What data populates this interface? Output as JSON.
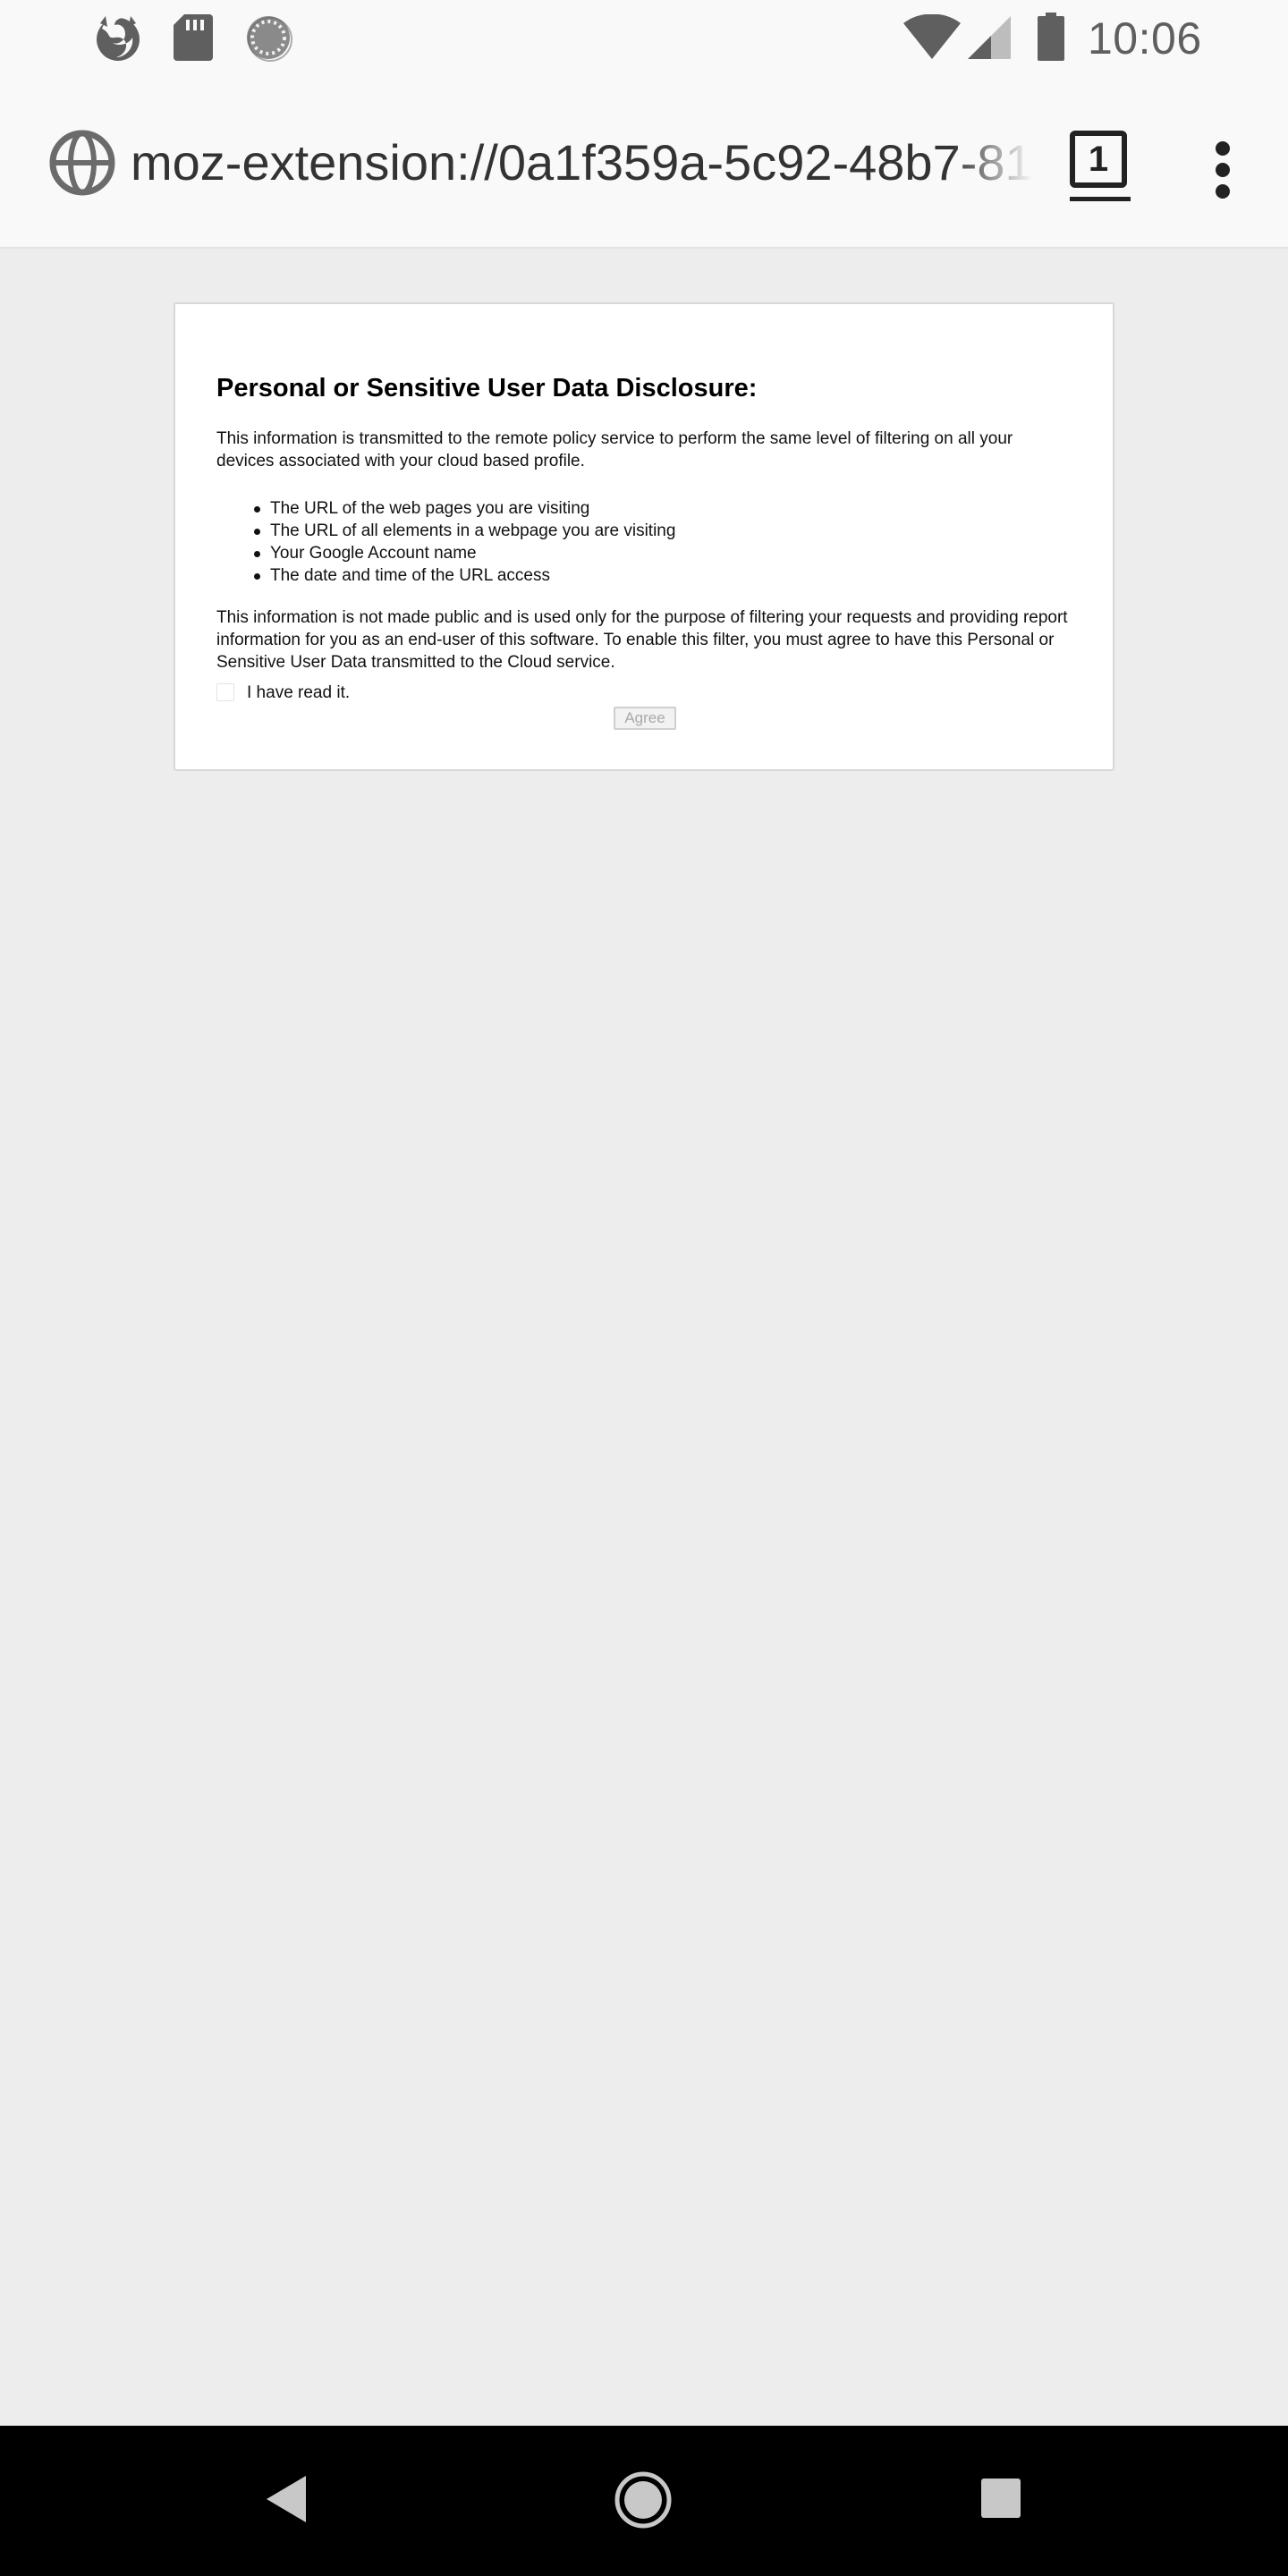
{
  "status_bar": {
    "time": "10:06",
    "notification_icons": [
      "firefox-icon",
      "sd-card-icon",
      "sync-icon"
    ],
    "system_icons": [
      "wifi-icon",
      "signal-icon",
      "battery-icon"
    ]
  },
  "toolbar": {
    "site_icon": "globe-icon",
    "url": "moz-extension://0a1f359a-5c92-48b7-81",
    "tab_count": "1",
    "menu_icon": "overflow-menu-icon"
  },
  "disclosure": {
    "title": "Personal or Sensitive User Data Disclosure:",
    "intro": "This information is transmitted to the remote policy service to perform the same level of filtering on all your devices associated with your cloud based profile.",
    "items": [
      "The URL of the web pages you are visiting",
      "The URL of all elements in a webpage you are visiting",
      "Your Google Account name",
      "The date and time of the URL access"
    ],
    "outro": "This information is not made public and is used only for the purpose of filtering your requests and providing report information for you as an end-user of this software. To enable this filter, you must agree to have this Personal or Sensitive User Data transmitted to the Cloud service.",
    "checkbox_label": "I have read it.",
    "checkbox_checked": false,
    "agree_label": "Agree",
    "agree_enabled": false
  },
  "nav_bar": {
    "buttons": [
      "back-icon",
      "home-icon",
      "recents-icon"
    ]
  },
  "colors": {
    "page_background": "#ededed",
    "toolbar_background": "#f9f9f9",
    "card_background": "#ffffff",
    "nav_background": "#000000"
  }
}
